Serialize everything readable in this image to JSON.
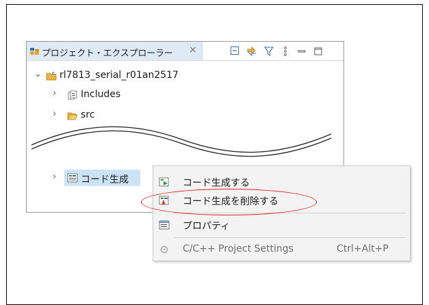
{
  "explorer": {
    "tab_title": "プロジェクト・エクスプローラー",
    "close_glyph": "×",
    "tab_icon": "project-explorer-icon",
    "toolbar": [
      "collapse-all-icon",
      "link-with-editor-icon",
      "filter-icon",
      "view-menu-icon",
      "minimize-icon",
      "maximize-icon"
    ]
  },
  "tree": {
    "project": {
      "label": "rl7813_serial_r01an2517",
      "icon": "project-folder-icon",
      "expanded": true
    },
    "items": [
      {
        "label": "Includes",
        "icon": "includes-icon"
      },
      {
        "label": "src",
        "icon": "folder-open-icon"
      }
    ],
    "selected_node": {
      "label": "コード生成",
      "icon": "code-generator-icon"
    }
  },
  "context_menu": {
    "items": [
      {
        "label": "コード生成する",
        "icon": "generate-code-icon",
        "enabled": true
      },
      {
        "label": "コード生成を削除する",
        "icon": "delete-generated-code-icon",
        "enabled": true,
        "highlighted": true
      },
      {
        "label": "プロパティ",
        "icon": "properties-icon",
        "enabled": true
      },
      {
        "label": "C/C++ Project Settings",
        "accel": "Ctrl+Alt+P",
        "icon": "project-settings-icon",
        "enabled": false
      }
    ]
  },
  "colors": {
    "selection": "#cce3f6",
    "tab_active": "#dfeaf7",
    "highlight": "#e02020"
  }
}
